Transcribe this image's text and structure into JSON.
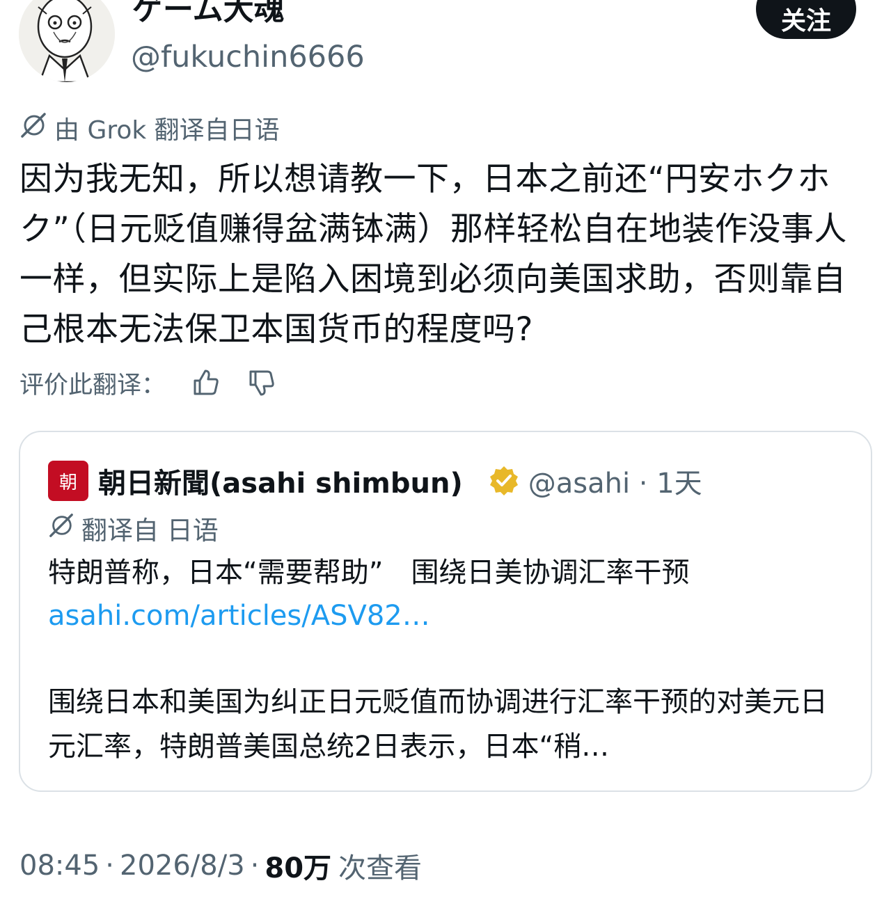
{
  "author": {
    "display_name": "ゲーム大魂",
    "handle": "@fukuchin6666",
    "follow_label": "关注"
  },
  "translation_badge": "由 Grok 翻译自日语",
  "post_text": "因为我无知，所以想请教一下，日本之前还“円安ホクホク”（日元贬值赚得盆满钵满）那样轻松自在地装作没事人一样，但实际上是陷入困境到必须向美国求助，否则靠自己根本无法保卫本国货币的程度吗?",
  "rate": {
    "label": "评价此翻译：",
    "like_icon": "thumbs-up-icon",
    "dislike_icon": "thumbs-down-icon"
  },
  "quote": {
    "logo_text": "朝",
    "name": "朝日新聞(asahi shimbun)",
    "verified_icon": "gold-verified-badge-icon",
    "handle_time": "@asahi · 1天",
    "translation_badge": "翻译自 日语",
    "title": "特朗普称，日本“需要帮助”　围绕日美协调汇率干预",
    "link": "asahi.com/articles/ASV82…",
    "body": "围绕日本和美国为纠正日元贬值而协调进行汇率干预的对美元日元汇率，特朗普美国总统2日表示，日本“稍…"
  },
  "meta": {
    "time": "08:45",
    "date": "2026/8/3",
    "views_count": "80万",
    "views_label": "次查看"
  },
  "colors": {
    "text": "#0f1419",
    "secondary": "#536471",
    "link": "#1d9bf0",
    "asahi_red": "#c30d23",
    "verified_gold": "#e8b829"
  }
}
